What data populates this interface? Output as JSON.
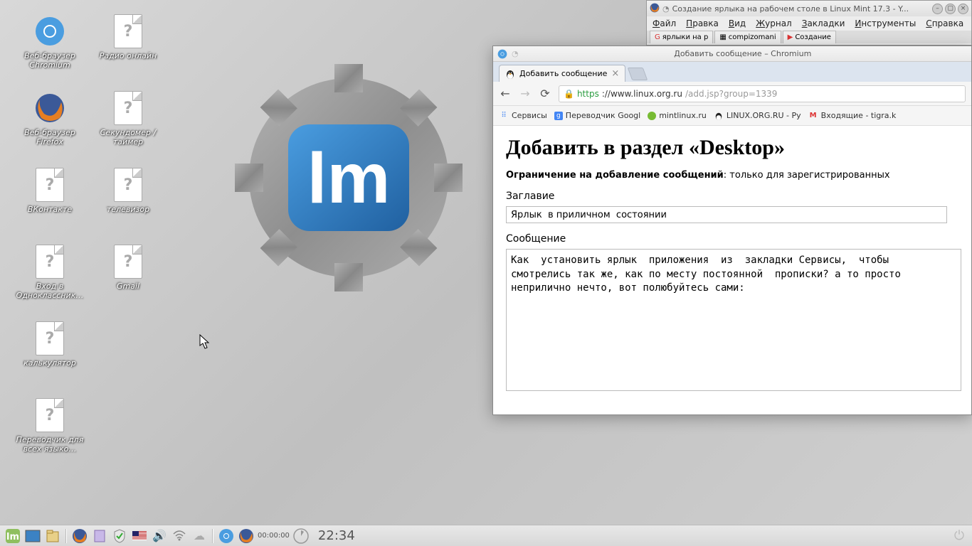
{
  "desktop_icons": {
    "chromium": "Веб-браузер Chromium",
    "radio": "Радио онлайн",
    "firefox_browser": "Веб-браузер Firefox",
    "timer": "Секундомер / таймер",
    "vk": "ВКонтакте",
    "tv": "телевизор",
    "odnoklassniki": "Вход в Одноклассник…",
    "gmail": "Gmail",
    "calculator": "калькулятор",
    "translator": "Переводчик для всех языко…"
  },
  "firefox": {
    "title": "Создание ярлыка на рабочем столе в Linux Mint 17.3 - Y...",
    "menu": [
      "Файл",
      "Правка",
      "Вид",
      "Журнал",
      "Закладки",
      "Инструменты",
      "Справка"
    ],
    "tabs": [
      "ярлыки на р",
      "compizomani",
      "Создание"
    ]
  },
  "chromium": {
    "window_title": "Добавить сообщение – Chromium",
    "tab_title": "Добавить сообщение",
    "url": {
      "proto": "https",
      "domain": "://www.linux.org.ru",
      "path": "/add.jsp?group=1339"
    },
    "bookmarks": [
      {
        "label": "Сервисы",
        "icon": "apps"
      },
      {
        "label": "Переводчик Googl",
        "icon": "g"
      },
      {
        "label": "mintlinux.ru",
        "icon": "mint"
      },
      {
        "label": "LINUX.ORG.RU - Ру",
        "icon": "tux"
      },
      {
        "label": "Входящие - tigra.k",
        "icon": "gmail"
      }
    ],
    "page": {
      "heading": "Добавить в раздел «Desktop»",
      "restriction_label": "Ограничение на добавление сообщений",
      "restriction_text": ": только для зарегистрированных",
      "title_label": "Заглавие",
      "title_value": "Ярлык  в приличном  состоянии",
      "message_label": "Сообщение",
      "message_value": "Как  установить ярлык  приложения  из  закладки Сервисы,  чтобы  смотрелись так же, как по месту постоянной  прописки? а то просто неприлично нечто, вот полюбуйтесь сами:"
    }
  },
  "taskbar": {
    "timer": "00:00:00",
    "clock": "22:34"
  }
}
